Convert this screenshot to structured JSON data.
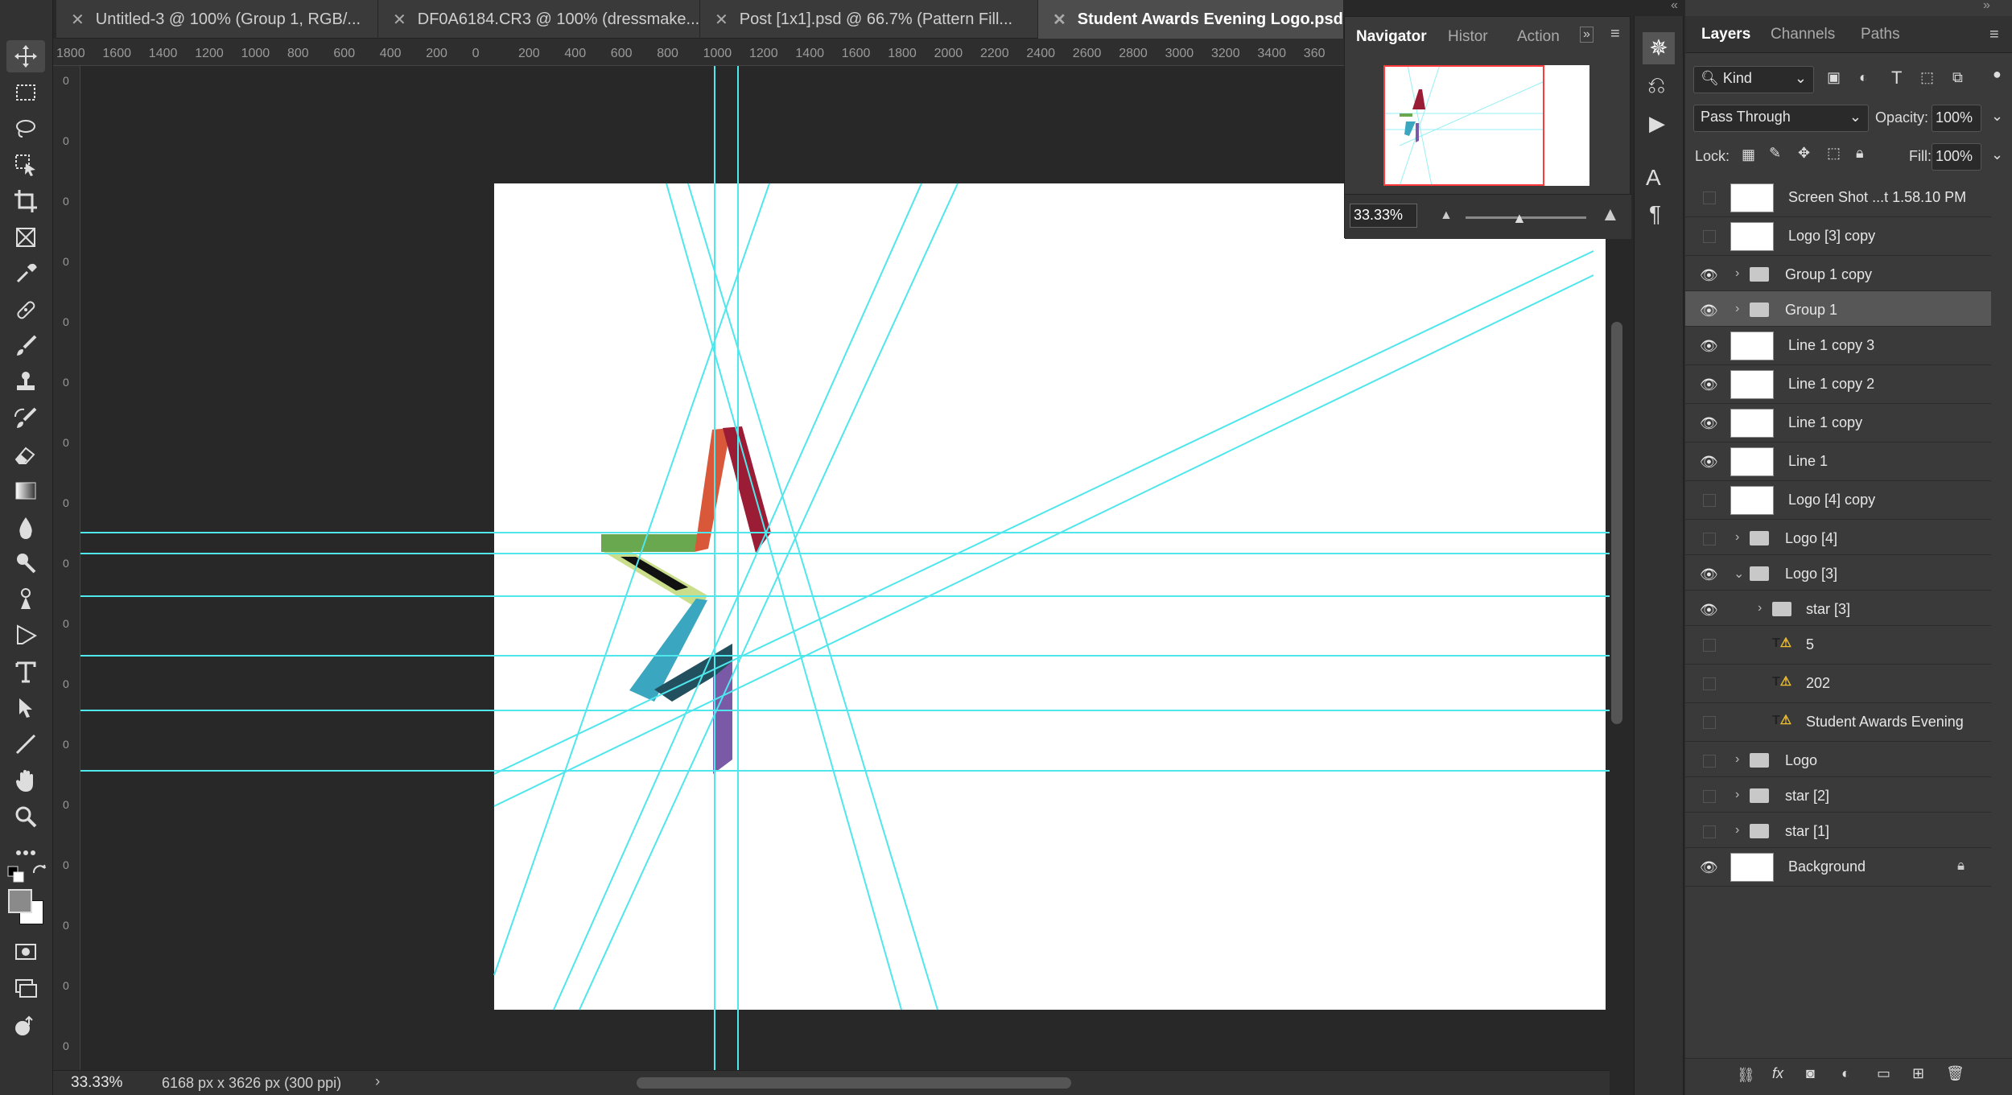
{
  "tabs": [
    {
      "label": "Untitled-3 @ 100% (Group 1, RGB/..."
    },
    {
      "label": "DF0A6184.CR3 @ 100% (dressmake..."
    },
    {
      "label": "Post [1x1].psd @ 66.7% (Pattern Fill..."
    },
    {
      "label": "Student Awards Evening Logo.psd"
    }
  ],
  "ruler": {
    "h_labels": [
      "1800",
      "1600",
      "1400",
      "1200",
      "1000",
      "800",
      "600",
      "400",
      "200",
      "0",
      "200",
      "400",
      "600",
      "800",
      "1000",
      "1200",
      "1400",
      "1600",
      "1800",
      "2000",
      "2200",
      "2400",
      "2600",
      "2800",
      "3000",
      "3200",
      "3400",
      "360"
    ],
    "v_labels": [
      "0",
      "0",
      "0",
      "0",
      "0",
      "0",
      "0",
      "0",
      "0",
      "0",
      "0",
      "0",
      "0",
      "0",
      "0",
      "0",
      "0"
    ]
  },
  "status": {
    "zoom": "33.33%",
    "doc_size": "6168 px x 3626 px (300 ppi)"
  },
  "navigator": {
    "tabs": [
      "Navigator",
      "Histor",
      "Action"
    ],
    "zoom": "33.33%"
  },
  "layers_panel": {
    "tabs": [
      "Layers",
      "Channels",
      "Paths"
    ],
    "filter_kind": "Kind",
    "blend_mode": "Pass Through",
    "opacity_label": "Opacity:",
    "opacity_value": "100%",
    "lock_label": "Lock:",
    "fill_label": "Fill:",
    "fill_value": "100%",
    "layers": [
      {
        "name": "Screen Shot ...t 1.58.10 PM",
        "kind": "smart",
        "visible": false
      },
      {
        "name": "Logo [3] copy",
        "kind": "smart",
        "visible": false
      },
      {
        "name": "Group 1 copy",
        "kind": "group",
        "visible": true
      },
      {
        "name": "Group 1",
        "kind": "group",
        "visible": true,
        "selected": true
      },
      {
        "name": "Line 1 copy 3",
        "kind": "shape",
        "visible": true
      },
      {
        "name": "Line 1 copy 2",
        "kind": "shape",
        "visible": true
      },
      {
        "name": "Line 1 copy",
        "kind": "shape",
        "visible": true
      },
      {
        "name": "Line 1",
        "kind": "shape",
        "visible": true
      },
      {
        "name": "Logo [4] copy",
        "kind": "pixel",
        "visible": false
      },
      {
        "name": "Logo [4]",
        "kind": "group",
        "visible": false
      },
      {
        "name": "Logo [3]",
        "kind": "group-open",
        "visible": true
      },
      {
        "name": "star [3]",
        "kind": "subgroup",
        "visible": true
      },
      {
        "name": "5",
        "kind": "text",
        "visible": false
      },
      {
        "name": "202",
        "kind": "text",
        "visible": false
      },
      {
        "name": "Student Awards Evening",
        "kind": "text",
        "visible": false
      },
      {
        "name": "Logo",
        "kind": "group",
        "visible": false
      },
      {
        "name": "star [2]",
        "kind": "group",
        "visible": false
      },
      {
        "name": "star [1]",
        "kind": "group",
        "visible": false
      },
      {
        "name": "Background",
        "kind": "background",
        "visible": true
      }
    ]
  },
  "colors": {
    "guide": "#4fe6ec",
    "red": "#9b1c35",
    "orange": "#d9583a",
    "green": "#6aa84f",
    "lime": "#c9dd8a",
    "teal": "#3aa6bf",
    "darkteal": "#23505f",
    "purple": "#7a5aa6"
  }
}
